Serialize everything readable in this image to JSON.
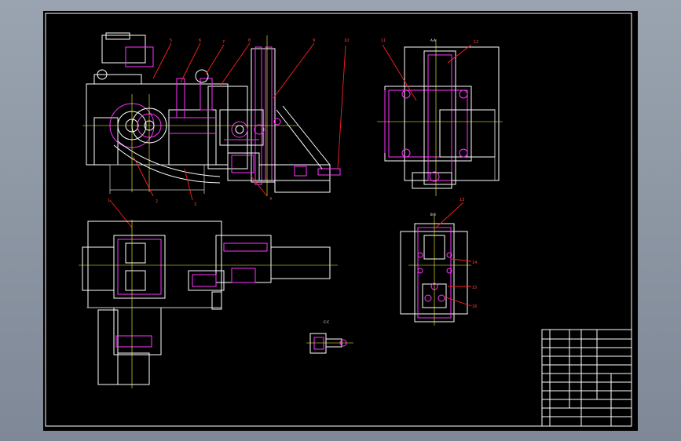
{
  "colors": {
    "background": "#8b94a1",
    "sheet": "#000000",
    "outline": "#ffffff",
    "accent": "#ff33ff",
    "leader": "#ff2020",
    "centerline": "#ffff40"
  },
  "part_numbers": [
    "5",
    "6",
    "7",
    "8",
    "9",
    "10",
    "11",
    "12",
    "1",
    "2",
    "3",
    "4",
    "13",
    "14",
    "15",
    "16"
  ],
  "section_marks": [
    "A-A",
    "B-B",
    "C-C"
  ],
  "title_block": {
    "rows": [
      "",
      "",
      "",
      "",
      "",
      "",
      "",
      "",
      "",
      "",
      ""
    ],
    "note": ""
  }
}
